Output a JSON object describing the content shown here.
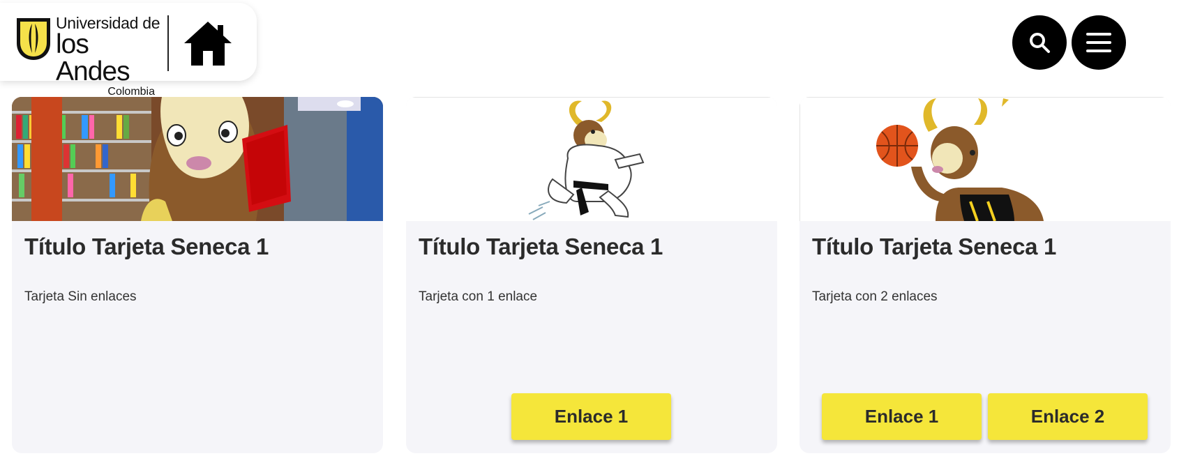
{
  "header": {
    "logo": {
      "line1": "Universidad de",
      "line2": "los Andes",
      "line3": "Colombia"
    },
    "home_icon": "home-icon",
    "search_icon": "search-icon",
    "menu_icon": "menu-icon"
  },
  "colors": {
    "accent_yellow": "#f5e63a",
    "card_bg": "#f5f5f9",
    "dark": "#000000"
  },
  "cards": [
    {
      "title": "Título Tarjeta Seneca 1",
      "description": "Tarjeta Sin enlaces",
      "links": []
    },
    {
      "title": "Título Tarjeta Seneca 1",
      "description": "Tarjeta con 1 enlace",
      "links": [
        "Enlace 1"
      ]
    },
    {
      "title": "Título Tarjeta Seneca 1",
      "description": "Tarjeta con 2 enlaces",
      "links": [
        "Enlace 1",
        "Enlace 2"
      ]
    }
  ]
}
